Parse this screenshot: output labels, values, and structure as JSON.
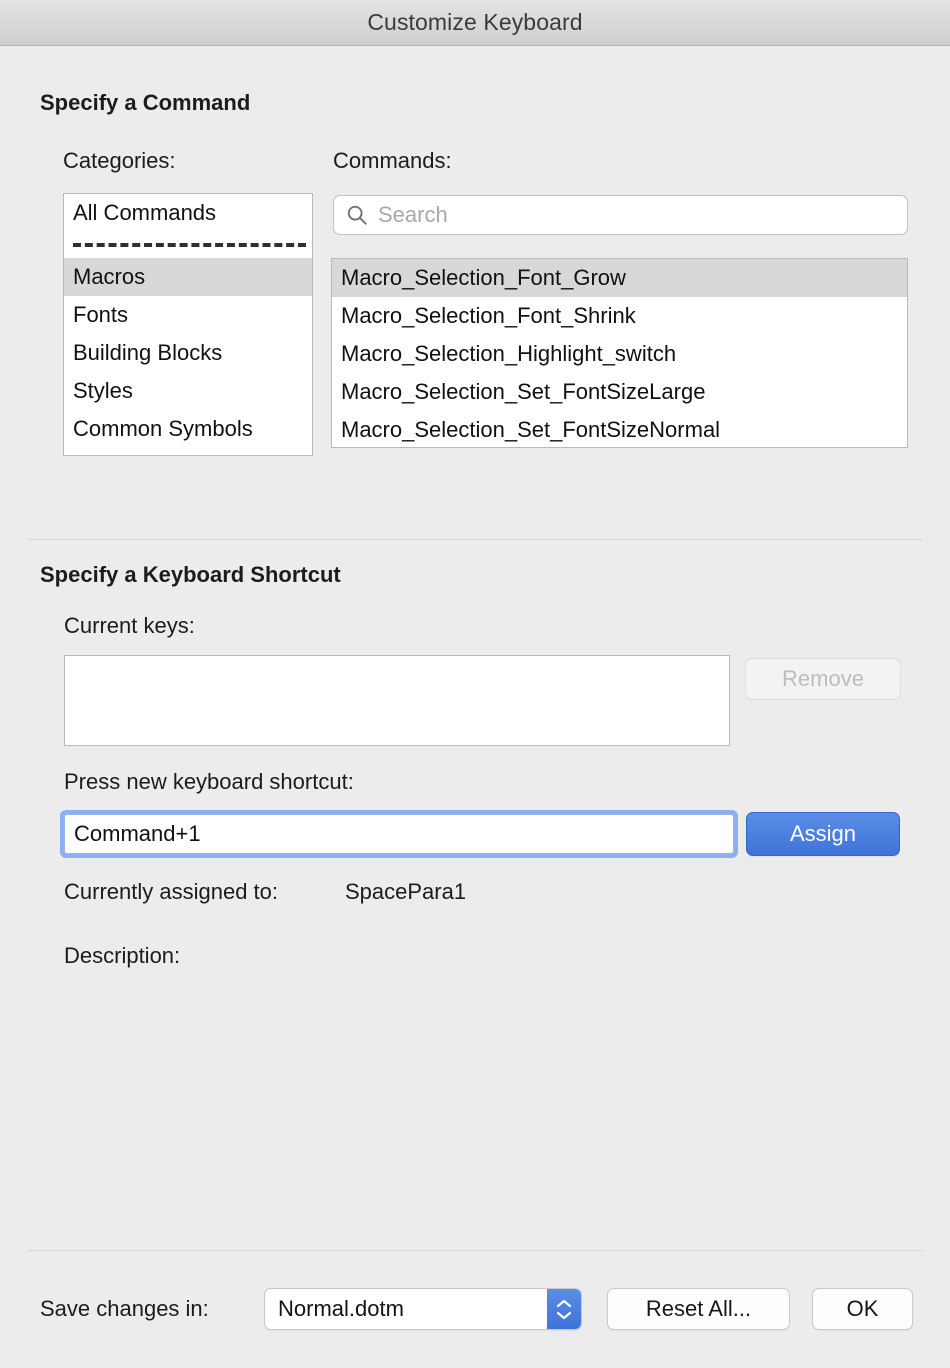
{
  "window": {
    "title": "Customize Keyboard"
  },
  "specify_command": {
    "heading": "Specify a Command",
    "categories_label": "Categories:",
    "categories": [
      {
        "label": "All Commands",
        "selected": false
      },
      {
        "separator": true
      },
      {
        "label": "Macros",
        "selected": true
      },
      {
        "label": "Fonts",
        "selected": false
      },
      {
        "label": "Building Blocks",
        "selected": false
      },
      {
        "label": "Styles",
        "selected": false
      },
      {
        "label": "Common Symbols",
        "selected": false
      }
    ],
    "commands_label": "Commands:",
    "search": {
      "icon": "search-icon",
      "placeholder": "Search",
      "value": ""
    },
    "commands": [
      {
        "label": "Macro_Selection_Font_Grow",
        "selected": true
      },
      {
        "label": "Macro_Selection_Font_Shrink",
        "selected": false
      },
      {
        "label": "Macro_Selection_Highlight_switch",
        "selected": false
      },
      {
        "label": "Macro_Selection_Set_FontSizeLarge",
        "selected": false
      },
      {
        "label": "Macro_Selection_Set_FontSizeNormal",
        "selected": false
      }
    ]
  },
  "specify_shortcut": {
    "heading": "Specify a Keyboard Shortcut",
    "current_keys_label": "Current keys:",
    "current_keys_value": "",
    "remove_label": "Remove",
    "press_new_label": "Press new keyboard shortcut:",
    "new_shortcut_value": "Command+1",
    "assign_label": "Assign",
    "currently_assigned_label": "Currently assigned to:",
    "currently_assigned_value": "SpacePara1",
    "description_label": "Description:",
    "description_value": ""
  },
  "footer": {
    "save_changes_label": "Save changes in:",
    "save_target": "Normal.dotm",
    "stepper_icon": "chevron-up-down-icon",
    "reset_all_label": "Reset All...",
    "ok_label": "OK"
  },
  "colors": {
    "accent_blue": "#3f73d9",
    "focus_ring": "#8fb0ef",
    "selection_gray": "#d8d8d8",
    "window_background": "#ececec",
    "divider": "#d6d6d6"
  }
}
